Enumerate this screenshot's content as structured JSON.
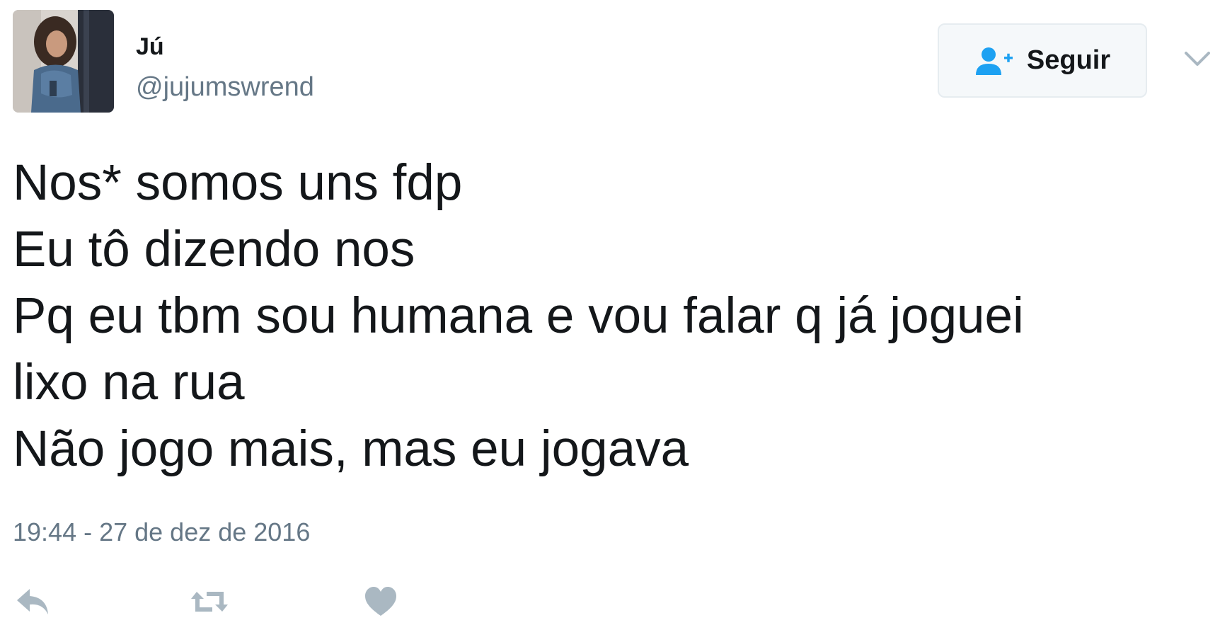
{
  "user": {
    "display_name": "Jú",
    "handle": "@jujumswrend",
    "avatar_icon": "profile-photo"
  },
  "follow_button": {
    "label": "Seguir",
    "icon": "add-user-icon",
    "accent_color": "#1da1f2"
  },
  "menu": {
    "icon": "chevron-down-icon"
  },
  "tweet": {
    "lines": [
      "Nos* somos uns fdp",
      "Eu tô dizendo nos",
      "Pq eu tbm sou humana e vou falar q já joguei",
      "lixo na rua",
      "Não jogo mais, mas eu jogava"
    ],
    "timestamp": "19:44 - 27 de dez de 2016"
  },
  "actions": [
    {
      "name": "reply",
      "icon": "reply-icon"
    },
    {
      "name": "retweet",
      "icon": "retweet-icon"
    },
    {
      "name": "like",
      "icon": "heart-icon"
    }
  ],
  "colors": {
    "text": "#14171a",
    "secondary_text": "#657786",
    "icon_gray": "#aab8c2",
    "accent": "#1da1f2"
  }
}
